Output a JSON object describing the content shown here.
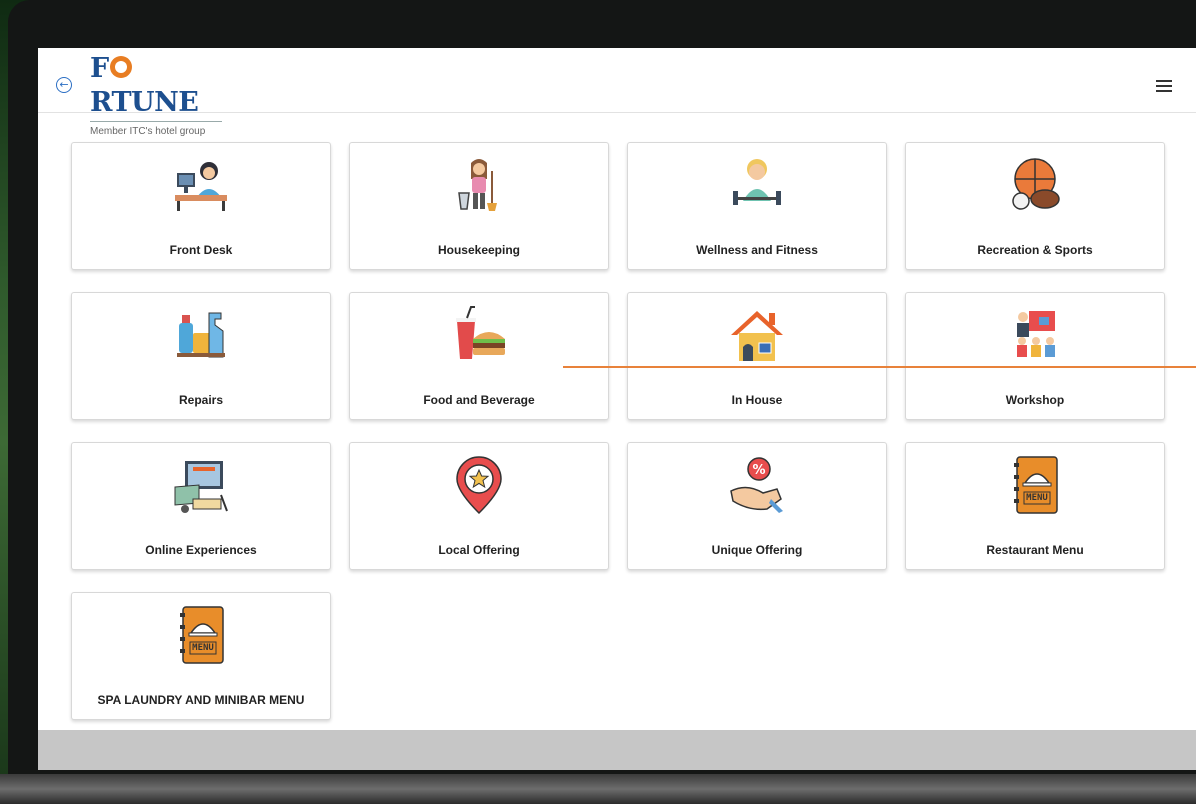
{
  "header": {
    "brand": "FRTUNE",
    "brand_first": "F",
    "brand_rest": "RTUNE",
    "tagline": "Member ITC's hotel group"
  },
  "tiles": [
    {
      "label": "Front Desk",
      "icon": "front-desk-icon"
    },
    {
      "label": "Housekeeping",
      "icon": "housekeeping-icon"
    },
    {
      "label": "Wellness and Fitness",
      "icon": "fitness-icon"
    },
    {
      "label": "Recreation & Sports",
      "icon": "sports-balls-icon"
    },
    {
      "label": "Repairs",
      "icon": "cleaning-supplies-icon"
    },
    {
      "label": "Food and Beverage",
      "icon": "burger-drink-icon"
    },
    {
      "label": "In House",
      "icon": "house-icon"
    },
    {
      "label": "Workshop",
      "icon": "workshop-icon"
    },
    {
      "label": "Online Experiences",
      "icon": "online-cooking-icon"
    },
    {
      "label": "Local Offering",
      "icon": "location-star-icon"
    },
    {
      "label": "Unique Offering",
      "icon": "hand-offer-icon"
    },
    {
      "label": "Restaurant Menu",
      "icon": "menu-book-icon"
    },
    {
      "label": "SPA LAUNDRY AND MINIBAR MENU",
      "icon": "menu-book-icon"
    }
  ],
  "colors": {
    "brand_blue": "#1d4f8f",
    "brand_orange": "#e87d22",
    "accent_line": "#e8823a"
  }
}
